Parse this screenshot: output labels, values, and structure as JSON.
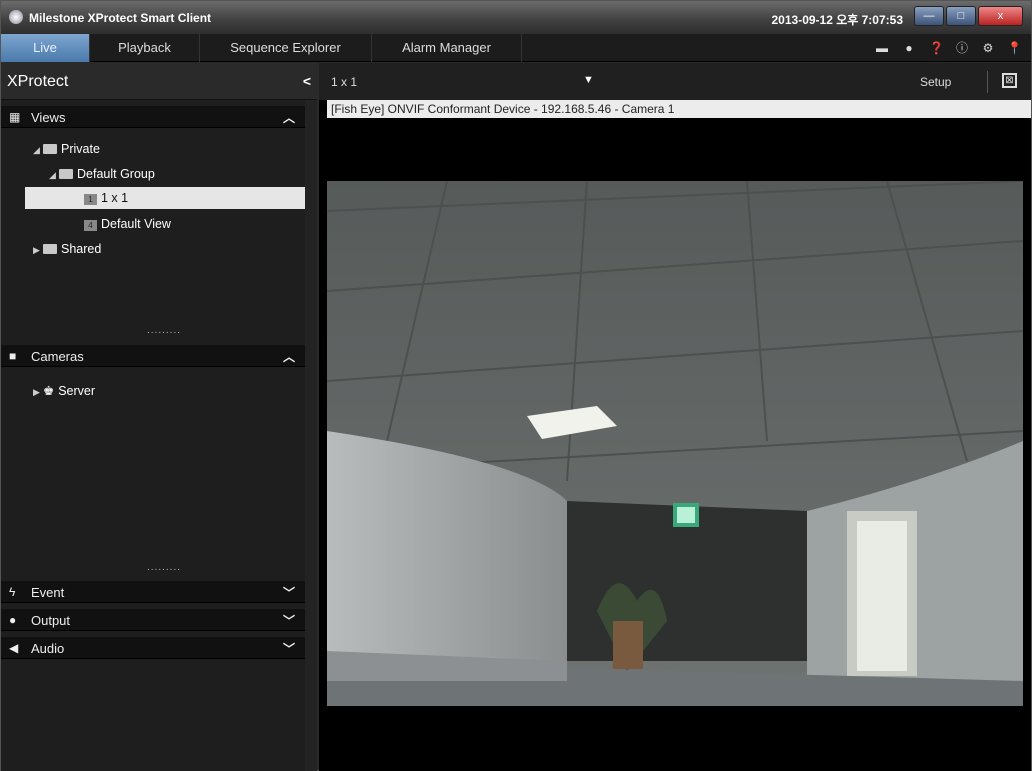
{
  "window": {
    "title": "Milestone XProtect Smart Client",
    "clock": "2013-09-12 오후 7:07:53",
    "min_glyph": "—",
    "max_glyph": "□",
    "close_glyph": "x"
  },
  "tabs": [
    {
      "label": "Live"
    },
    {
      "label": "Playback"
    },
    {
      "label": "Sequence Explorer"
    },
    {
      "label": "Alarm Manager"
    }
  ],
  "toolbar_icons": [
    "screen-icon",
    "disconnect-icon",
    "help-icon",
    "info-icon",
    "gear-icon",
    "pin-icon"
  ],
  "panel": {
    "title": "XProtect",
    "collapse": "<"
  },
  "sections": {
    "views": {
      "label": "Views",
      "icon": "grid-icon"
    },
    "cameras": {
      "label": "Cameras",
      "icon": "camera-icon"
    },
    "event": {
      "label": "Event",
      "icon": "lightning-icon"
    },
    "output": {
      "label": "Output",
      "icon": "bulb-icon"
    },
    "audio": {
      "label": "Audio",
      "icon": "speaker-icon"
    }
  },
  "tree": {
    "private": "Private",
    "default_group": "Default Group",
    "view_1x1": "1 x 1",
    "view_1x1_badge": "1",
    "default_view": "Default View",
    "default_view_badge": "4",
    "shared": "Shared",
    "server": "Server"
  },
  "grip": ".........",
  "viewbar": {
    "view": "1 x 1",
    "setup": "Setup"
  },
  "camera": {
    "title": "[Fish Eye] ONVIF Conformant Device - 192.168.5.46 - Camera 1"
  },
  "colors": {
    "accent": "#5a86b6",
    "background": "#1e1e1e"
  }
}
